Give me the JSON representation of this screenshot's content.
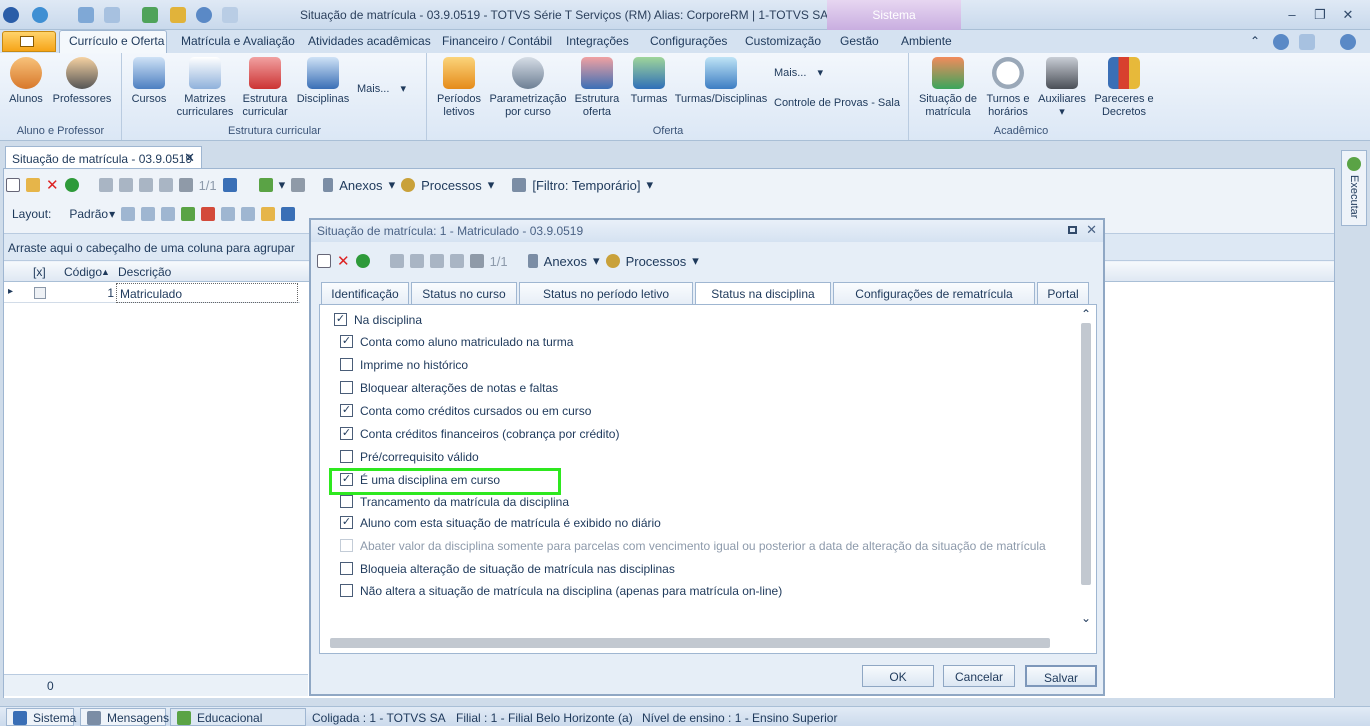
{
  "window": {
    "title": "Situação de matrícula - 03.9.0519 - TOTVS Série T Serviços (RM) Alias: CorporeRM | 1-TOTVS SA",
    "context_tab": "Sistema",
    "min": "–",
    "restore": "❐",
    "close": "✕"
  },
  "ribbon_tabs": [
    "Currículo e Oferta",
    "Matrícula e Avaliação",
    "Atividades acadêmicas",
    "Financeiro / Contábil",
    "Integrações",
    "Configurações",
    "Customização",
    "Gestão",
    "Ambiente"
  ],
  "ribbon": {
    "aluno_prof": {
      "label": "Aluno e Professor",
      "alunos": "Alunos",
      "professores": "Professores"
    },
    "estrutura": {
      "label": "Estrutura curricular",
      "cursos": "Cursos",
      "matrizes": "Matrizes curriculares",
      "estrutura": "Estrutura curricular",
      "disciplinas": "Disciplinas",
      "mais": "Mais..."
    },
    "oferta": {
      "label": "Oferta",
      "periodos": "Períodos letivos",
      "parametrizacao": "Parametrização por curso",
      "estrutura_oferta": "Estrutura oferta",
      "turmas": "Turmas",
      "turmas_disc": "Turmas/Disciplinas",
      "mais": "Mais...",
      "controle": "Controle de Provas - Sala"
    },
    "academico": {
      "label": "Acadêmico",
      "situacao": "Situação de matrícula",
      "turnos": "Turnos e horários",
      "auxiliares": "Auxiliares",
      "pareceres": "Pareceres e Decretos"
    }
  },
  "doc_tab": {
    "label": "Situação de matrícula - 03.9.0519",
    "close": "✕"
  },
  "toolbar": {
    "page": "1/1",
    "anexos": "Anexos",
    "processos": "Processos",
    "filtro": "[Filtro: Temporário]",
    "layout": "Layout:",
    "padrao": "Padrão"
  },
  "grid": {
    "group_hint": "Arraste aqui o cabeçalho de uma coluna para agrupar",
    "col_check": "[x]",
    "col_code": "Código",
    "col_desc": "Descrição",
    "row_code": "1",
    "row_desc": "Matriculado",
    "row_marker": "▸",
    "footer_count": "0"
  },
  "right_panel": {
    "executar": "Executar"
  },
  "dialog": {
    "title": "Situação de matrícula: 1 - Matriculado - 03.9.0519",
    "page": "1/1",
    "anexos": "Anexos",
    "processos": "Processos",
    "tabs": [
      "Identificação",
      "Status no curso",
      "Status no período letivo",
      "Status na disciplina",
      "Configurações de rematrícula",
      "Portal"
    ],
    "group_label": "Na disciplina",
    "options": [
      {
        "label": "Conta como aluno matriculado na turma",
        "checked": true
      },
      {
        "label": "Imprime no histórico",
        "checked": false
      },
      {
        "label": "Bloquear alterações de notas e faltas",
        "checked": false
      },
      {
        "label": "Conta como créditos cursados ou em curso",
        "checked": true
      },
      {
        "label": "Conta créditos financeiros (cobrança por crédito)",
        "checked": true
      },
      {
        "label": "Pré/correquisito válido",
        "checked": false
      },
      {
        "label": "É uma disciplina em curso",
        "checked": true
      },
      {
        "label": "Trancamento da matrícula da disciplina",
        "checked": false
      },
      {
        "label": "Aluno com esta situação de matrícula é exibido no diário",
        "checked": true
      },
      {
        "label": "Abater valor da disciplina somente para parcelas com vencimento igual ou posterior a data de alteração da situação de matrícula",
        "checked": false,
        "disabled": true
      },
      {
        "label": "Bloqueia alteração de situação de matrícula nas disciplinas",
        "checked": false
      },
      {
        "label": "Não altera a situação de matrícula na disciplina (apenas para matrícula on-line)",
        "checked": false
      }
    ],
    "ok": "OK",
    "cancel": "Cancelar",
    "save": "Salvar"
  },
  "status": {
    "sistema": "Sistema",
    "mensagens": "Mensagens",
    "educacional": "Educacional",
    "coligada": "Coligada : 1 - TOTVS SA",
    "filial": "Filial : 1 - Filial Belo Horizonte (a)",
    "nivel": "Nível de ensino : 1 - Ensino Superior"
  },
  "glyphs": {
    "dropdown": "▾",
    "check": "✓",
    "sort_up": "▲",
    "up": "⌃",
    "down": "⌄"
  },
  "colors": {
    "highlight": "#2ee81f",
    "accent": "#f6a418"
  }
}
